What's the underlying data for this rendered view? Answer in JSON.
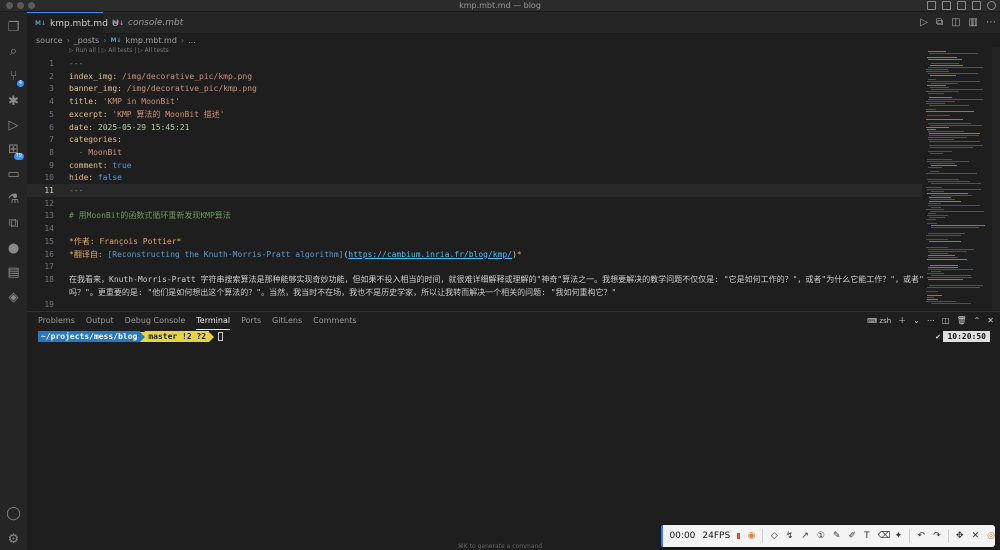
{
  "window": {
    "title": "kmp.mbt.md — blog"
  },
  "tabs": [
    {
      "icon_text": "M↓",
      "label": "kmp.mbt.md",
      "status": "U",
      "active": true
    },
    {
      "icon_text": "M↓",
      "label": "console.mbt",
      "active": false
    }
  ],
  "breadcrumb": [
    "source",
    "_posts",
    "kmp.mbt.md",
    "..."
  ],
  "codelens": "▷ Run all | ▷ All tests | ▷ All tests",
  "editor": {
    "lines": [
      {
        "n": "1",
        "parts": [
          [
            "dash",
            "---"
          ]
        ]
      },
      {
        "n": "2",
        "parts": [
          [
            "key",
            "index_img:"
          ],
          [
            "str",
            " /img/decorative_pic/kmp.png"
          ]
        ]
      },
      {
        "n": "3",
        "parts": [
          [
            "key",
            "banner_img:"
          ],
          [
            "str",
            " /img/decorative_pic/kmp.png"
          ]
        ]
      },
      {
        "n": "4",
        "parts": [
          [
            "key",
            "title:"
          ],
          [
            "str",
            " 'KMP in MoonBit'"
          ]
        ]
      },
      {
        "n": "5",
        "parts": [
          [
            "key",
            "excerpt:"
          ],
          [
            "str",
            " 'KMP 算法的 MoonBit 描述'"
          ]
        ]
      },
      {
        "n": "6",
        "parts": [
          [
            "key",
            "date:"
          ],
          [
            "num",
            " 2025-05-29 15:45:21"
          ]
        ]
      },
      {
        "n": "7",
        "parts": [
          [
            "key",
            "categories:"
          ]
        ]
      },
      {
        "n": "8",
        "parts": [
          [
            "dash",
            "  - "
          ],
          [
            "str",
            "MoonBit"
          ]
        ]
      },
      {
        "n": "9",
        "parts": [
          [
            "key",
            "comment:"
          ],
          [
            "bool",
            " true"
          ]
        ]
      },
      {
        "n": "10",
        "parts": [
          [
            "key",
            "hide:"
          ],
          [
            "bool",
            " false"
          ]
        ]
      },
      {
        "n": "11",
        "parts": [
          [
            "dash",
            "---"
          ]
        ],
        "current": true
      },
      {
        "n": "12",
        "parts": []
      },
      {
        "n": "13",
        "parts": [
          [
            "hd",
            "# 用MoonBit的函数式循环重新发现KMP算法"
          ]
        ]
      },
      {
        "n": "14",
        "parts": []
      },
      {
        "n": "15",
        "parts": [
          [
            "em",
            "*作者: François Pottier*"
          ]
        ]
      },
      {
        "n": "16",
        "parts": [
          [
            "em",
            "*翻译自: "
          ],
          [
            "lnk",
            "[Reconstructing the Knuth-Morris-Pratt algorithm]"
          ],
          [
            "para",
            "("
          ],
          [
            "url",
            "https://cambium.inria.fr/blog/kmp/"
          ],
          [
            "para",
            ")"
          ],
          [
            "em",
            "*"
          ]
        ]
      },
      {
        "n": "17",
        "parts": []
      },
      {
        "n": "18",
        "parts": [
          [
            "para",
            "在我看来，Knuth-Morris-Pratt 字符串搜索算法是那种能够实现奇妙功能，但如果不投入相当的时间，就很难详细解释或理解的\"神奇\"算法之一。我想要解决的教学问题不仅仅是: \"它是如何工作的？\"，或者\"为什么它能工作？\"，或者\"它真的能工作"
          ]
        ]
      },
      {
        "n": "",
        "parts": [
          [
            "para",
            "吗？\"。更重要的是: \"他们是如何想出这个算法的？\"。当然，我当时不在场，我也不是历史学家，所以让我转而解决一个相关的问题: \"我如何重构它？\""
          ]
        ]
      },
      {
        "n": "19",
        "parts": []
      }
    ]
  },
  "panel": {
    "tabs": [
      "Problems",
      "Output",
      "Debug Console",
      "Terminal",
      "Ports",
      "GitLens",
      "Comments"
    ],
    "active_tab": "Terminal",
    "terminal_name": "zsh",
    "prompt_path": "~/projects/mess/blog",
    "prompt_git": " master !2 ?2",
    "rprompt_check": "✔",
    "rprompt_time": "10:20:50"
  },
  "status_hint": "⌘K to generate a command",
  "recorder": {
    "time": "00:00",
    "fps": "24FPS"
  },
  "colors": {
    "accent": "#3794ff",
    "prompt_blue": "#2878c3",
    "prompt_yellow": "#e5d44a"
  }
}
